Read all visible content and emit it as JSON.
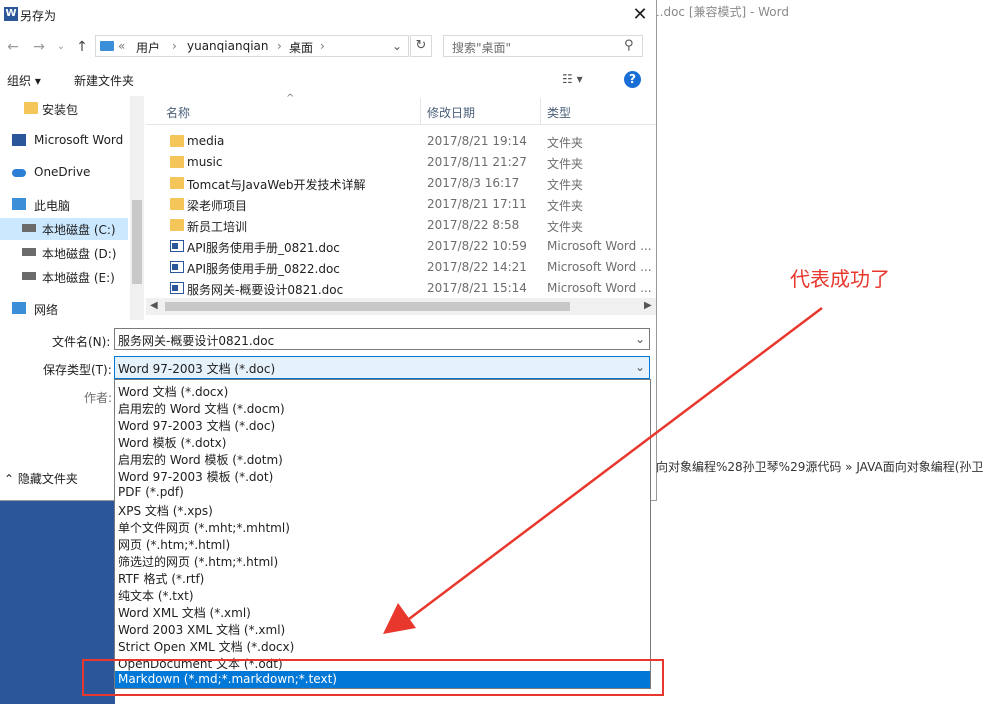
{
  "word": {
    "title_fragment": "1.doc [兼容模式] - Word",
    "crumb_fragment": "向对象编程%28孙卫琴%29源代码 » JAVA面向对象编程(孙卫"
  },
  "dialog": {
    "title": "另存为",
    "title_icon": "W",
    "close_glyph": "✕",
    "address": {
      "sep0": "«",
      "crumbs": [
        "用户",
        "yuanqianqian",
        "桌面"
      ],
      "sep": "›"
    },
    "search_placeholder": "搜索\"桌面\"",
    "toolbar": {
      "organize": "组织 ▾",
      "new_folder": "新建文件夹",
      "view_glyph": "☷ ▾",
      "help_glyph": "?"
    },
    "nav": [
      {
        "label": "安装包",
        "icon": "folder-icon"
      },
      {
        "label": "Microsoft Word",
        "icon": "word-icon"
      },
      {
        "label": "OneDrive",
        "icon": "cloud-icon"
      },
      {
        "label": "此电脑",
        "icon": "computer-icon"
      },
      {
        "label": "本地磁盘 (C:)",
        "icon": "drive-icon"
      },
      {
        "label": "本地磁盘 (D:)",
        "icon": "drive-icon"
      },
      {
        "label": "本地磁盘 (E:)",
        "icon": "drive-icon"
      },
      {
        "label": "网络",
        "icon": "network-icon"
      }
    ],
    "columns": {
      "name": "名称",
      "modified": "修改日期",
      "type": "类型"
    },
    "files": [
      {
        "name": "media",
        "date": "2017/8/21 19:14",
        "type": "文件夹",
        "kind": "folder"
      },
      {
        "name": "music",
        "date": "2017/8/11 21:27",
        "type": "文件夹",
        "kind": "folder"
      },
      {
        "name": "Tomcat与JavaWeb开发技术详解",
        "date": "2017/8/3 16:17",
        "type": "文件夹",
        "kind": "folder"
      },
      {
        "name": "梁老师项目",
        "date": "2017/8/21 17:11",
        "type": "文件夹",
        "kind": "folder"
      },
      {
        "name": "新员工培训",
        "date": "2017/8/22 8:58",
        "type": "文件夹",
        "kind": "folder"
      },
      {
        "name": "API服务使用手册_0821.doc",
        "date": "2017/8/22 10:59",
        "type": "Microsoft Word ...",
        "kind": "doc"
      },
      {
        "name": "API服务使用手册_0822.doc",
        "date": "2017/8/22 14:21",
        "type": "Microsoft Word ...",
        "kind": "doc"
      },
      {
        "name": "服务网关-概要设计0821.doc",
        "date": "2017/8/21 15:14",
        "type": "Microsoft Word ...",
        "kind": "doc"
      }
    ],
    "form": {
      "filename_label": "文件名(N):",
      "filename_value": "服务网关-概要设计0821.doc",
      "type_label": "保存类型(T):",
      "type_value": "Word 97-2003 文档 (*.doc)",
      "author_label": "作者:",
      "hide_folders": "隐藏文件夹"
    },
    "type_options": [
      "Word 文档 (*.docx)",
      "启用宏的 Word 文档 (*.docm)",
      "Word 97-2003 文档 (*.doc)",
      "Word 模板 (*.dotx)",
      "启用宏的 Word 模板 (*.dotm)",
      "Word 97-2003 模板 (*.dot)",
      "PDF (*.pdf)",
      "XPS 文档 (*.xps)",
      "单个文件网页 (*.mht;*.mhtml)",
      "网页 (*.htm;*.html)",
      "筛选过的网页 (*.htm;*.html)",
      "RTF 格式 (*.rtf)",
      "纯文本 (*.txt)",
      "Word XML 文档 (*.xml)",
      "Word 2003 XML 文档 (*.xml)",
      "Strict Open XML 文档 (*.docx)",
      "OpenDocument 文本 (*.odt)",
      "Markdown (*.md;*.markdown;*.text)"
    ],
    "selected_option_index": 17
  },
  "annotation": {
    "text": "代表成功了",
    "color": "#e8382d"
  },
  "colors": {
    "accent": "#0078d7",
    "word_blue": "#2b579a",
    "selection": "#cce8ff"
  }
}
